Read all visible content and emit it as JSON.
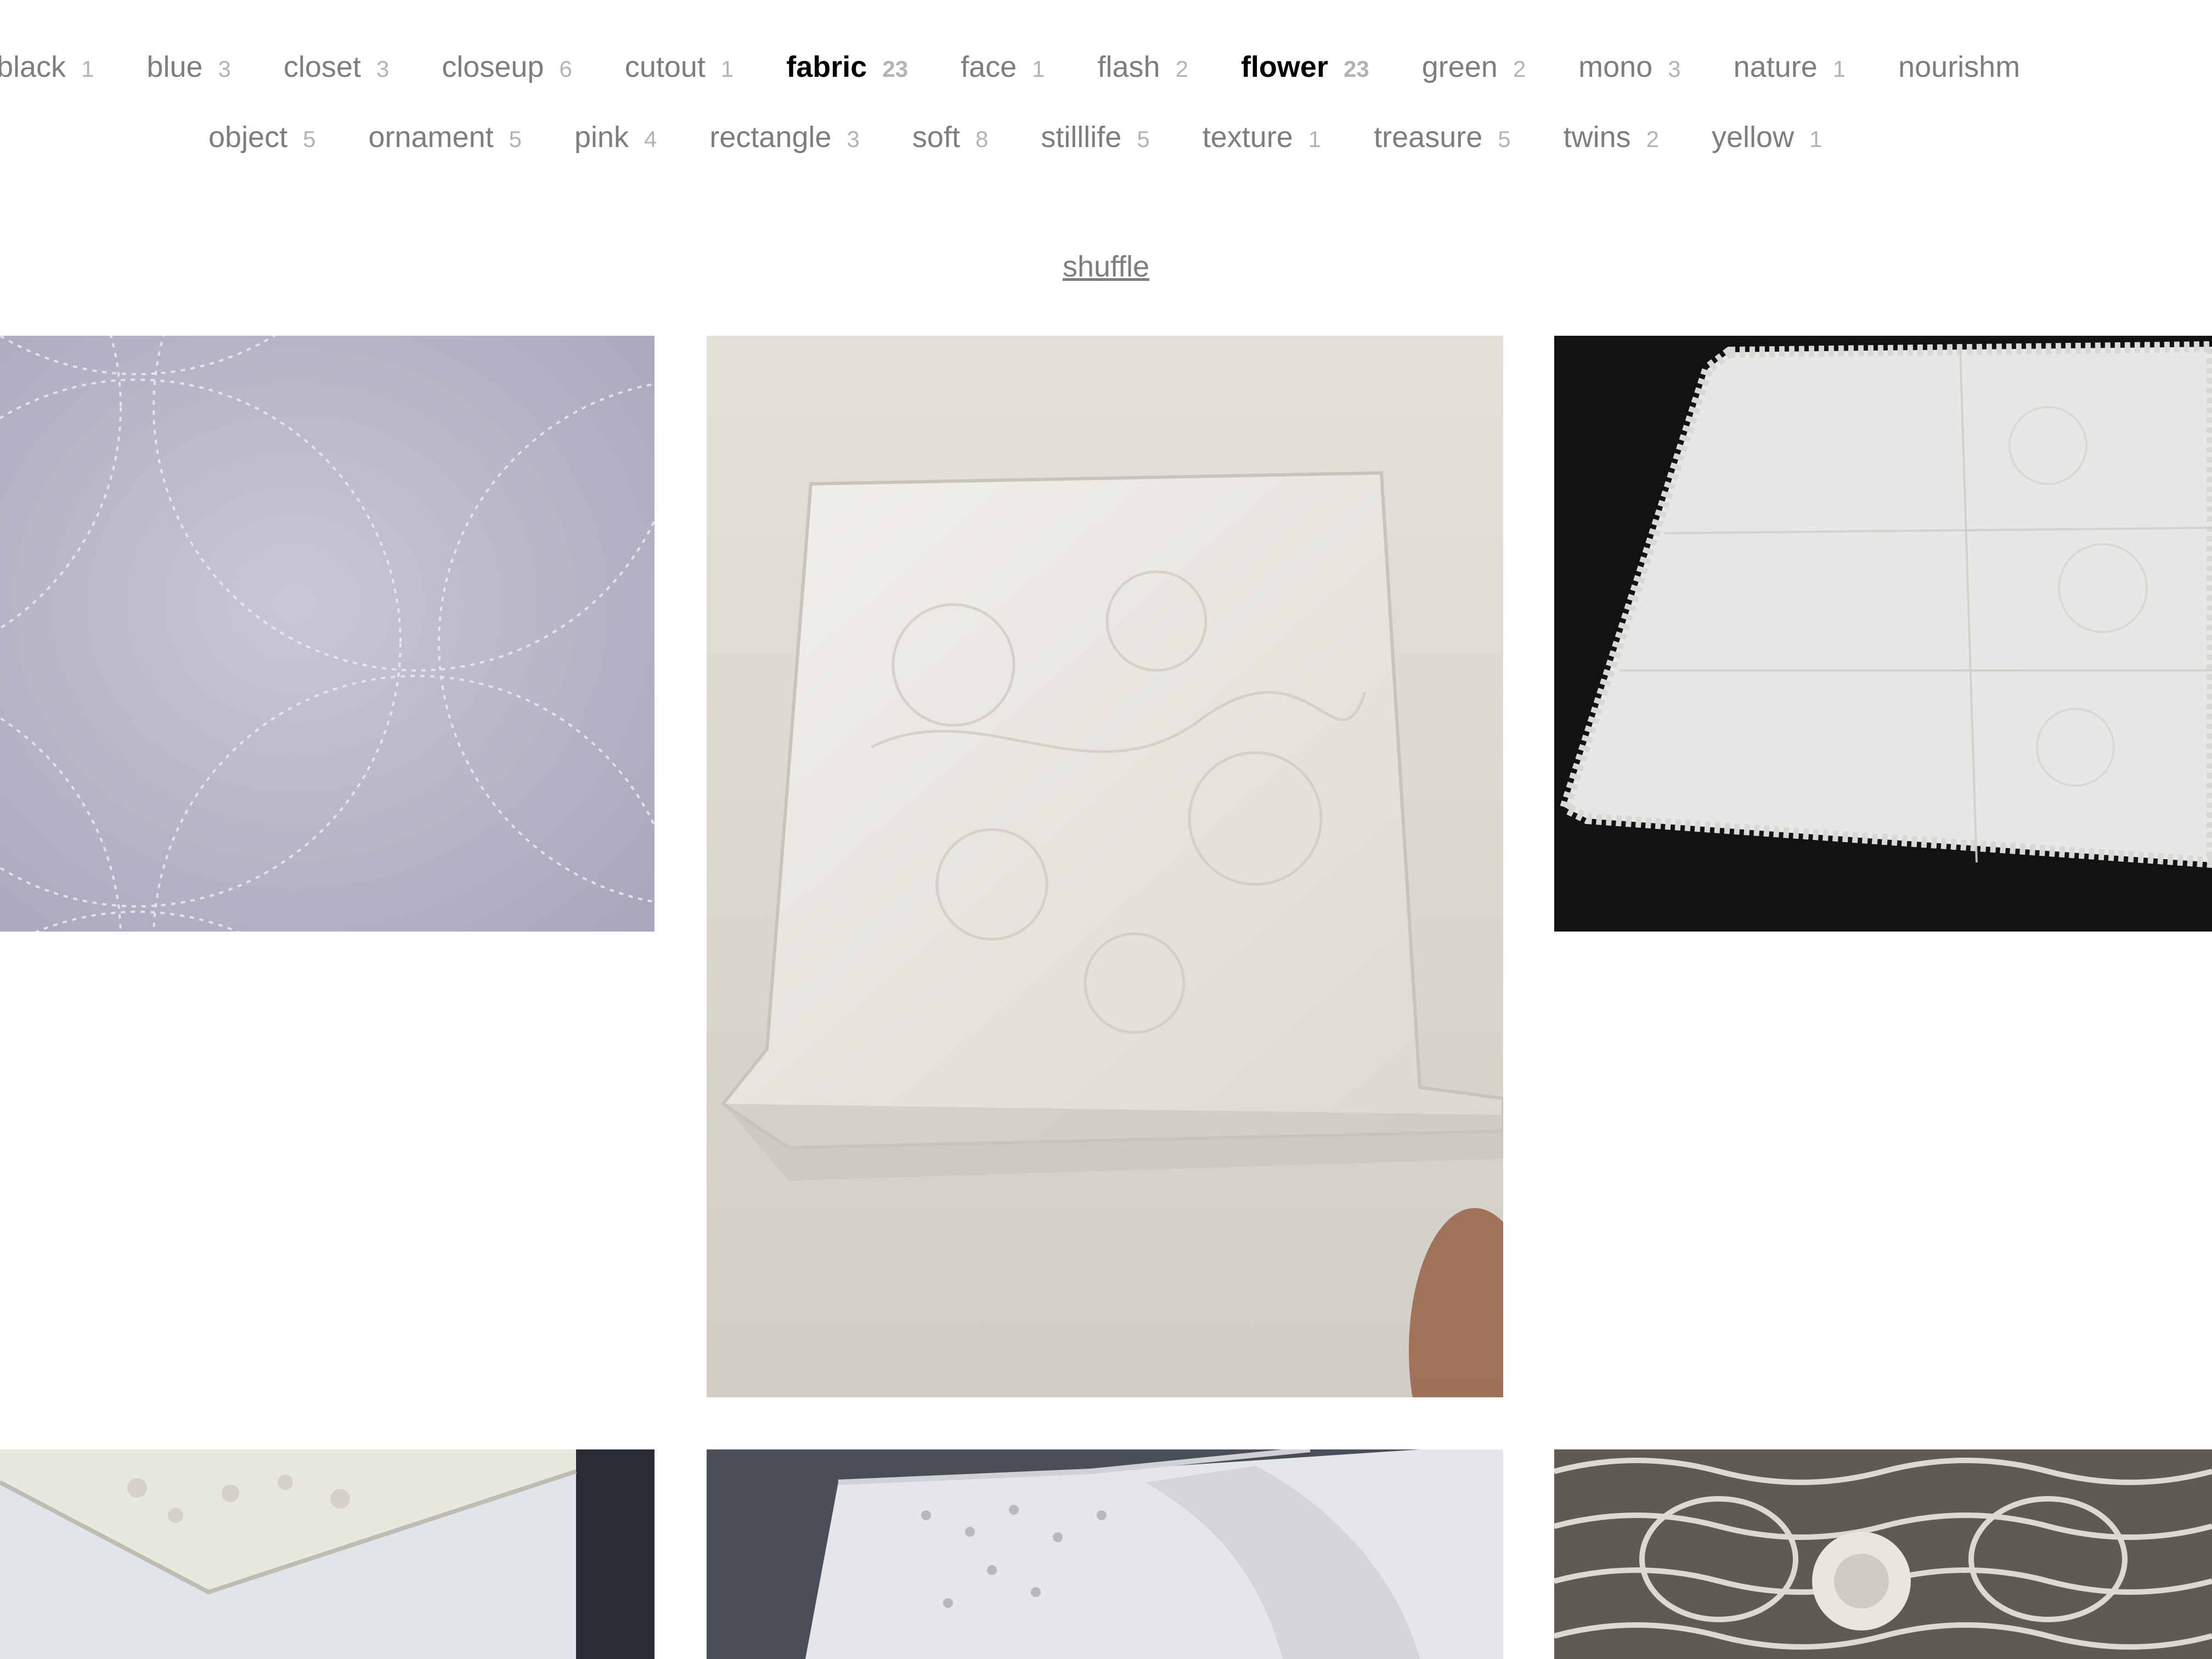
{
  "tags_row1": [
    {
      "name": "black",
      "count": "1",
      "active": false
    },
    {
      "name": "blue",
      "count": "3",
      "active": false
    },
    {
      "name": "closet",
      "count": "3",
      "active": false
    },
    {
      "name": "closeup",
      "count": "6",
      "active": false
    },
    {
      "name": "cutout",
      "count": "1",
      "active": false
    },
    {
      "name": "fabric",
      "count": "23",
      "active": true
    },
    {
      "name": "face",
      "count": "1",
      "active": false
    },
    {
      "name": "flash",
      "count": "2",
      "active": false
    },
    {
      "name": "flower",
      "count": "23",
      "active": true
    },
    {
      "name": "green",
      "count": "2",
      "active": false
    },
    {
      "name": "mono",
      "count": "3",
      "active": false
    },
    {
      "name": "nature",
      "count": "1",
      "active": false
    },
    {
      "name": "nourishm",
      "count": "",
      "active": false
    }
  ],
  "tags_row2": [
    {
      "name": "object",
      "count": "5",
      "active": false
    },
    {
      "name": "ornament",
      "count": "5",
      "active": false
    },
    {
      "name": "pink",
      "count": "4",
      "active": false
    },
    {
      "name": "rectangle",
      "count": "3",
      "active": false
    },
    {
      "name": "soft",
      "count": "8",
      "active": false
    },
    {
      "name": "stilllife",
      "count": "5",
      "active": false
    },
    {
      "name": "texture",
      "count": "1",
      "active": false
    },
    {
      "name": "treasure",
      "count": "5",
      "active": false
    },
    {
      "name": "twins",
      "count": "2",
      "active": false
    },
    {
      "name": "yellow",
      "count": "1",
      "active": false
    }
  ],
  "shuffle_label": "shuffle",
  "colors": {
    "tag_text": "#7e7e7e",
    "tag_count": "#b3b3b3",
    "tag_active": "#000000",
    "background": "#ffffff"
  }
}
